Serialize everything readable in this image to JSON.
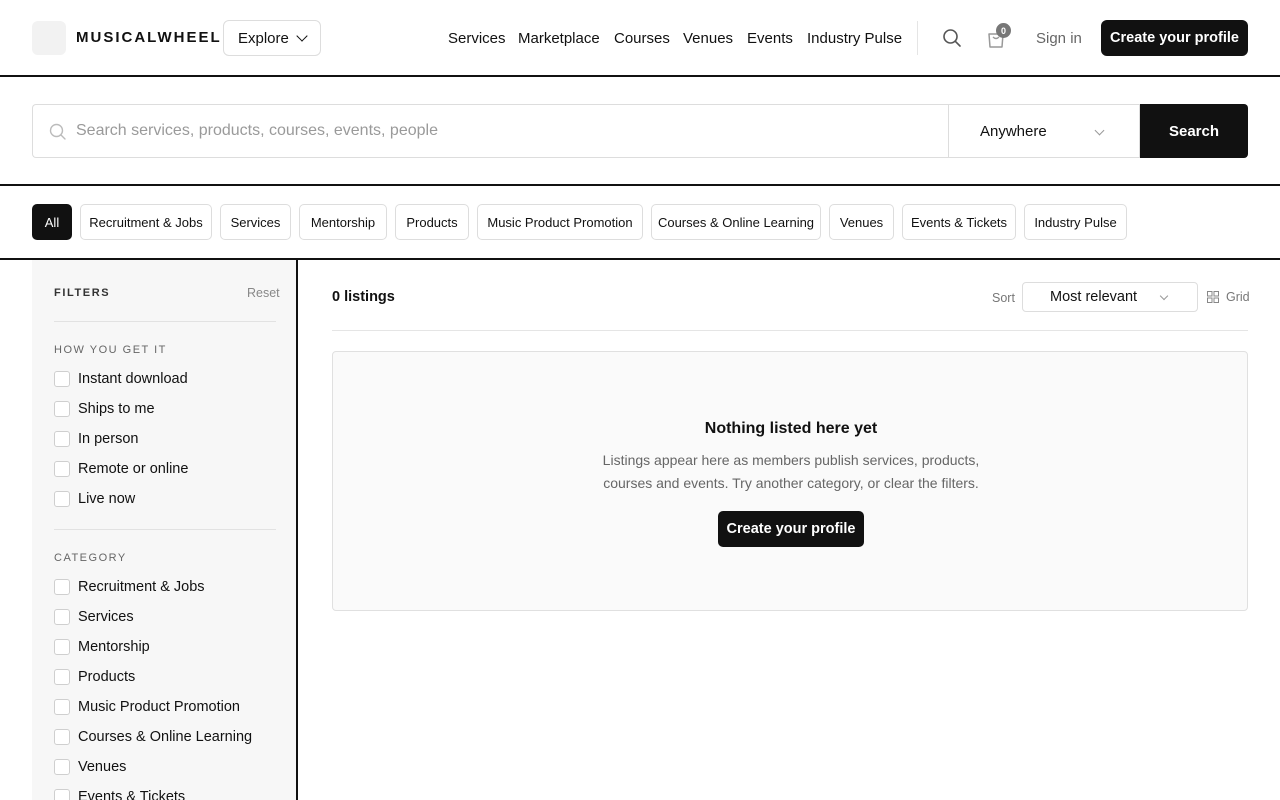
{
  "header": {
    "logo": "MUSICALWHEEL",
    "explore_label": "Explore",
    "nav": [
      "Services",
      "Marketplace",
      "Courses",
      "Venues",
      "Events",
      "Industry Pulse"
    ],
    "cart_count": "0",
    "signin_label": "Sign in",
    "create_label": "Create your profile",
    "icons": {
      "search": "search-icon",
      "cart": "shopping-bag-icon",
      "explore_chevron": "chevron-down-icon"
    }
  },
  "search": {
    "placeholder": "Search services, products, courses, events, people",
    "location": "Anywhere",
    "button_label": "Search"
  },
  "categories": [
    "All",
    "Recruitment & Jobs",
    "Services",
    "Mentorship",
    "Products",
    "Music Product Promotion",
    "Courses & Online Learning",
    "Venues",
    "Events & Tickets",
    "Industry Pulse"
  ],
  "active_category": "All",
  "filters": {
    "title": "FILTERS",
    "reset_label": "Reset",
    "how_title": "HOW YOU GET IT",
    "how_options": [
      "Instant download",
      "Ships to me",
      "In person",
      "Remote or online",
      "Live now"
    ],
    "category_title": "CATEGORY",
    "category_options": [
      "Recruitment & Jobs",
      "Services",
      "Mentorship",
      "Products",
      "Music Product Promotion",
      "Courses & Online Learning",
      "Venues",
      "Events & Tickets"
    ]
  },
  "results": {
    "count_label": "0 listings",
    "sort_label": "Sort",
    "sort_value": "Most relevant",
    "view_label": "Grid",
    "empty_title": "Nothing listed here yet",
    "empty_desc": "Listings appear here as members publish services, products, courses and events. Try another category, or clear the filters.",
    "empty_button": "Create your profile"
  },
  "colors": {
    "primary": "#111111",
    "muted": "#666666",
    "sidebar_bg": "#f7f7f7",
    "border": "#dddddd"
  }
}
